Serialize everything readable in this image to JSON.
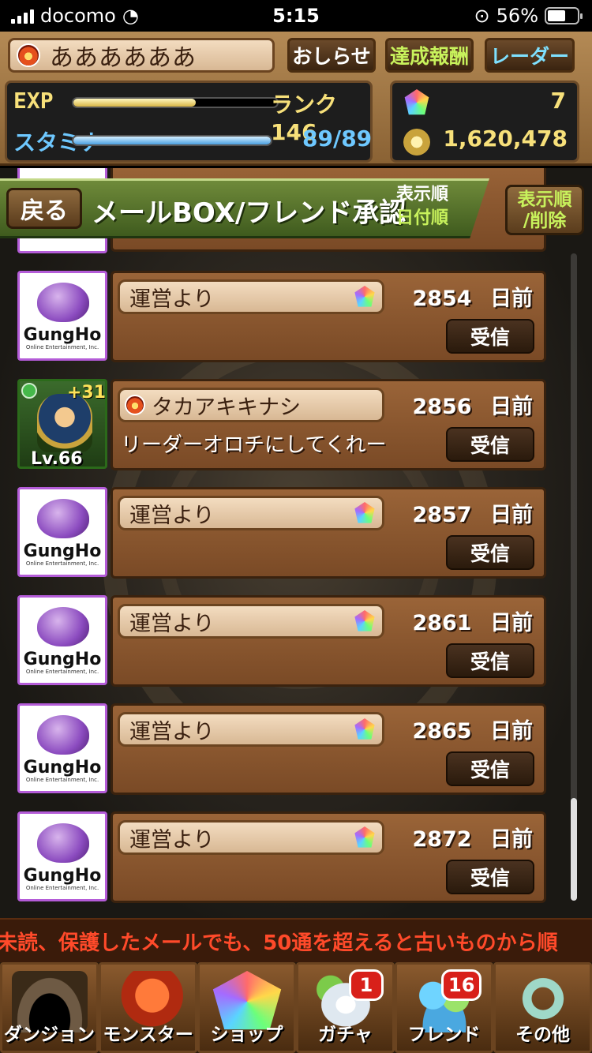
{
  "status_bar": {
    "carrier": "docomo",
    "time": "5:15",
    "battery": "56%"
  },
  "header": {
    "player_name": "ああああああ",
    "buttons": {
      "news": "おしらせ",
      "reward": "達成報酬",
      "radar": "レーダー"
    },
    "exp_label": "EXP",
    "exp_progress": 0.6,
    "rank": "ランク 146",
    "stamina_label": "スタミナ",
    "stamina_value": "89/89",
    "stamina_progress": 1.0,
    "magic_stones": "7",
    "coins": "1,620,478"
  },
  "title_bar": {
    "back": "戻る",
    "title": "メールBOX/フレンド承認",
    "sort_label": "表示順",
    "sort_value": "日付順",
    "sort_button_line1": "表示順",
    "sort_button_line2": "/削除"
  },
  "mails": [
    {
      "sender": "運営より",
      "days": "2854",
      "unit": "日前",
      "action": "受信",
      "kind": "official"
    },
    {
      "sender": "タカアキキナシ",
      "days": "2856",
      "unit": "日前",
      "action": "受信",
      "kind": "friend",
      "message": "リーダーオロチにしてくれー",
      "monster_plus": "+31",
      "monster_level": "Lv.66"
    },
    {
      "sender": "運営より",
      "days": "2857",
      "unit": "日前",
      "action": "受信",
      "kind": "official"
    },
    {
      "sender": "運営より",
      "days": "2861",
      "unit": "日前",
      "action": "受信",
      "kind": "official"
    },
    {
      "sender": "運営より",
      "days": "2865",
      "unit": "日前",
      "action": "受信",
      "kind": "official"
    },
    {
      "sender": "運営より",
      "days": "2872",
      "unit": "日前",
      "action": "受信",
      "kind": "official"
    }
  ],
  "official_logo": {
    "name": "GungHo",
    "sub": "Online Entertainment, Inc."
  },
  "ticker": "未読、保護したメールでも、50通を超えると古いものから順",
  "nav": [
    {
      "label": "ダンジョン",
      "art": "dungeon"
    },
    {
      "label": "モンスター",
      "art": "monster"
    },
    {
      "label": "ショップ",
      "art": "shop"
    },
    {
      "label": "ガチャ",
      "art": "gacha",
      "badge": "1"
    },
    {
      "label": "フレンド",
      "art": "friend",
      "badge": "16"
    },
    {
      "label": "その他",
      "art": "other"
    }
  ]
}
